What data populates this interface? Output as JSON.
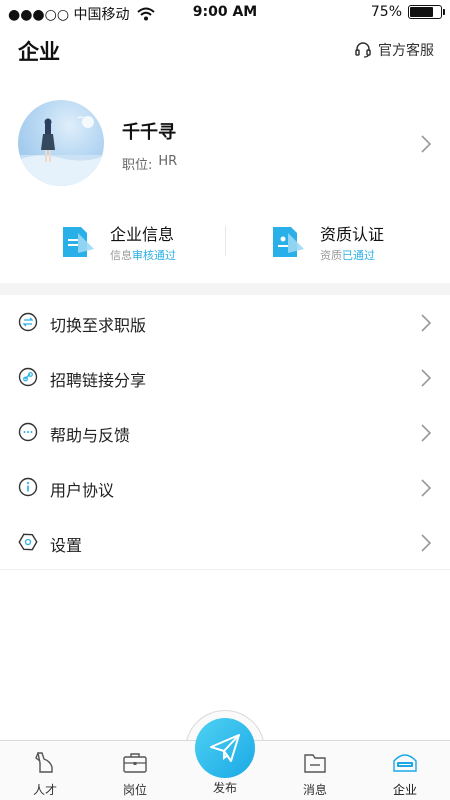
{
  "status_bar": {
    "carrier": "●●●○○ 中国移动",
    "time": "9:00 AM",
    "battery_text": "75%",
    "battery_level": 0.75
  },
  "header": {
    "title": "企业",
    "service_label": "官方客服",
    "service_icon": "headset-icon"
  },
  "profile": {
    "name": "千千寻",
    "role_label": "职位:",
    "role_value": "HR"
  },
  "info_cards": [
    {
      "title": "企业信息",
      "sub_prefix": "信息",
      "sub_status": "审核通过",
      "icon": "document-icon"
    },
    {
      "title": "资质认证",
      "sub_prefix": "资质",
      "sub_status": "已通过",
      "icon": "id-card-icon"
    }
  ],
  "menu": [
    {
      "label": "切换至求职版",
      "icon": "switch-icon"
    },
    {
      "label": "招聘链接分享",
      "icon": "link-icon"
    },
    {
      "label": "帮助与反馈",
      "icon": "chat-bubble-icon"
    },
    {
      "label": "用户协议",
      "icon": "info-icon"
    },
    {
      "label": "设置",
      "icon": "settings-hexagon-icon"
    }
  ],
  "tabbar": {
    "tabs": [
      {
        "label": "人才",
        "icon": "person-icon"
      },
      {
        "label": "岗位",
        "icon": "briefcase-icon"
      },
      {
        "label": "发布",
        "icon": "paper-plane-icon"
      },
      {
        "label": "消息",
        "icon": "message-box-icon"
      },
      {
        "label": "企业",
        "icon": "company-badge-icon"
      }
    ],
    "active": "企业"
  },
  "colors": {
    "accent": "#1aa9e6",
    "status_ok": "#2ab0e8",
    "divider": "#f4f4f4"
  }
}
